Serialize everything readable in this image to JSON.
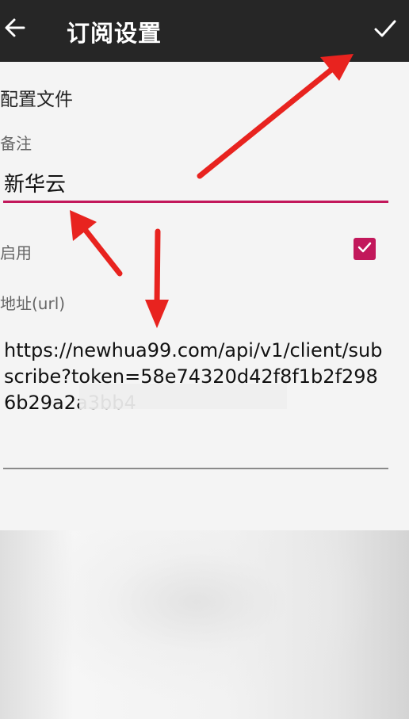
{
  "appbar": {
    "title": "订阅设置",
    "back_icon": "arrow-left-icon",
    "confirm_icon": "checkmark-icon"
  },
  "form": {
    "section_title": "配置文件",
    "note_label": "备注",
    "note_value": "新华云",
    "enable_label": "启用",
    "enable_checked": true,
    "url_label": "地址(url)",
    "url_value": "https://newhua99.com/api/v1/client/subscribe?token=58e74320d42f8f1b2f2986b29a2a3bb4"
  },
  "colors": {
    "appbar_bg": "#262626",
    "accent": "#c2185b",
    "annotation_arrow": "#e8231f"
  }
}
